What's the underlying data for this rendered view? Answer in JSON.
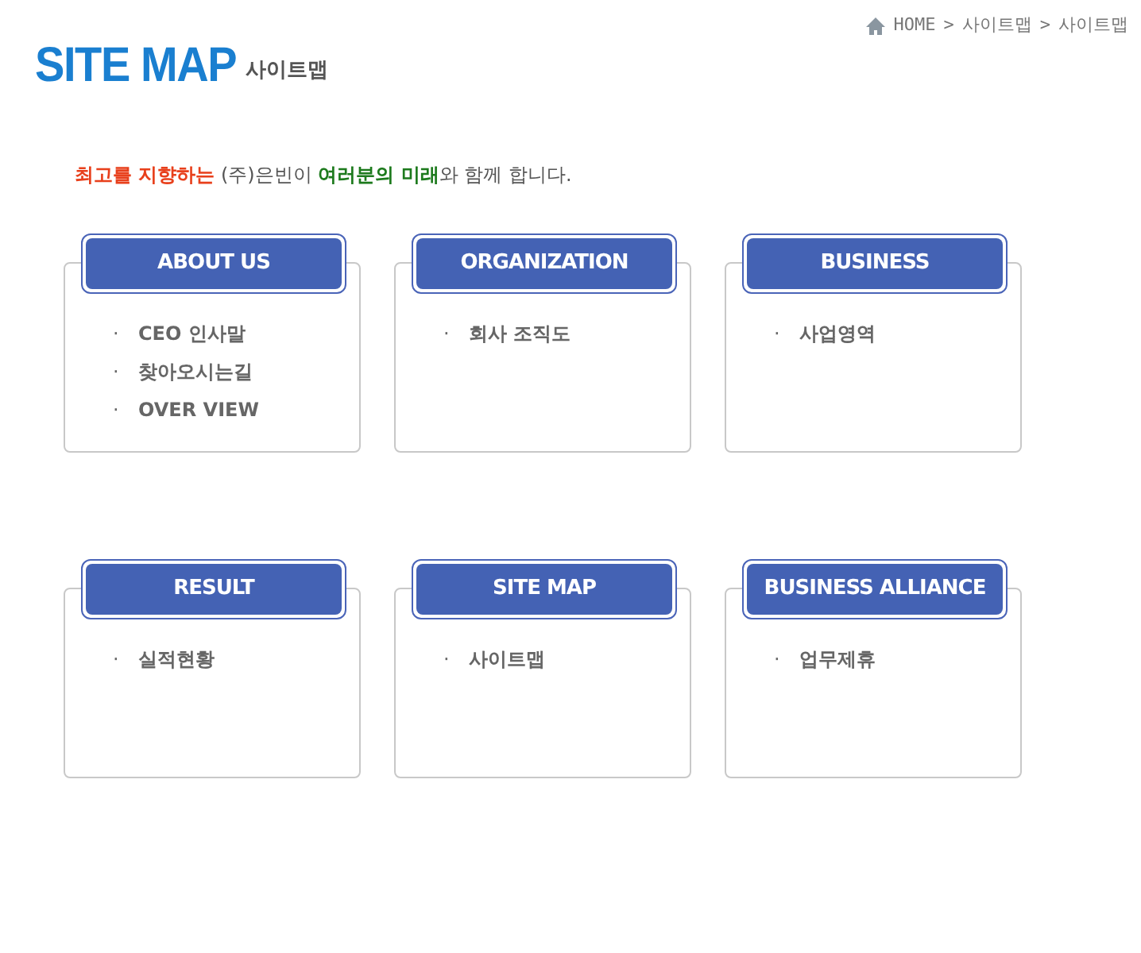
{
  "breadcrumb": {
    "items": [
      "HOME",
      ">",
      "사이트맵",
      ">",
      "사이트맵"
    ]
  },
  "page_title": {
    "main": "SITE MAP",
    "sub": "사이트맵"
  },
  "tagline": [
    {
      "text": "최고를 지향하는",
      "kind": "slogan"
    },
    {
      "text": " (주)은빈이 ",
      "kind": "plain"
    },
    {
      "text": "여러분의 미래",
      "kind": "future"
    },
    {
      "text": "와 함께 합니다.",
      "kind": "plain"
    }
  ],
  "sections": [
    {
      "title": "ABOUT US",
      "items": [
        {
          "bullet": "·",
          "label": "CEO 인사말"
        },
        {
          "bullet": "·",
          "label": "찾아오시는길"
        },
        {
          "bullet": "·",
          "label": "OVER VIEW"
        }
      ]
    },
    {
      "title": "ORGANIZATION",
      "items": [
        {
          "bullet": "·",
          "label": "회사 조직도"
        }
      ]
    },
    {
      "title": "BUSINESS",
      "items": [
        {
          "bullet": "·",
          "label": "사업영역"
        }
      ]
    },
    {
      "title": "RESULT",
      "items": [
        {
          "bullet": "·",
          "label": "실적현황"
        }
      ]
    },
    {
      "title": "SITE MAP",
      "items": [
        {
          "bullet": "·",
          "label": "사이트맵"
        }
      ]
    },
    {
      "title": "BUSINESS ALLIANCE",
      "items": [
        {
          "bullet": "·",
          "label": "업무제휴"
        }
      ]
    }
  ]
}
